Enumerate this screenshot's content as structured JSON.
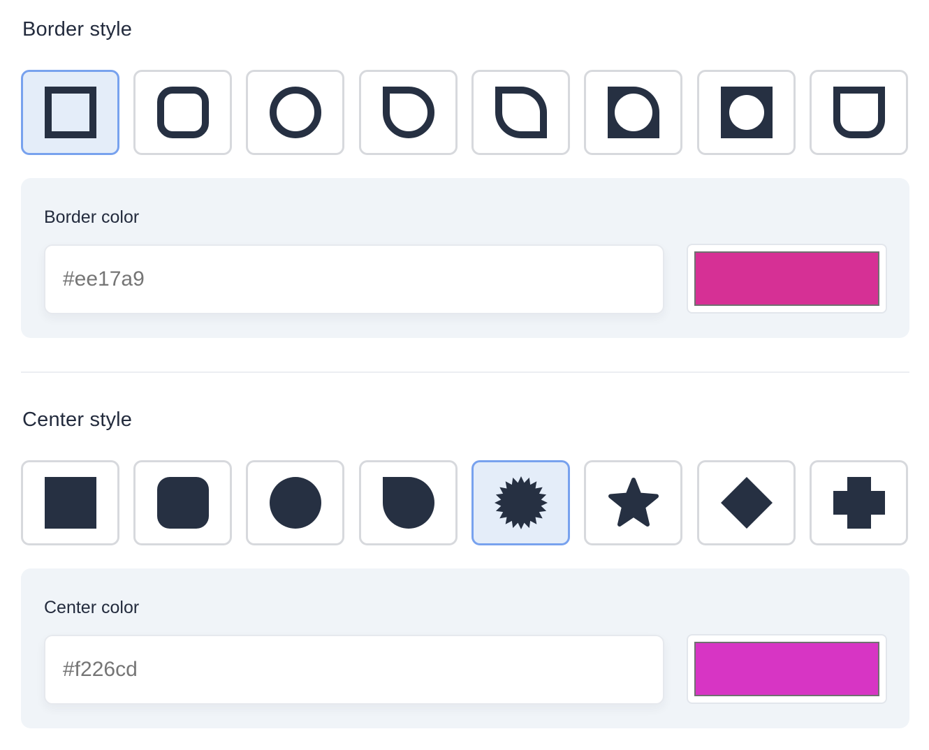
{
  "border_section": {
    "title": "Border style",
    "options": [
      {
        "icon": "square-frame-icon",
        "selected": true
      },
      {
        "icon": "rounded-square-frame-icon",
        "selected": false
      },
      {
        "icon": "circle-frame-icon",
        "selected": false
      },
      {
        "icon": "half-rounded-frame-icon",
        "selected": false
      },
      {
        "icon": "leaf-frame-icon",
        "selected": false
      },
      {
        "icon": "leaf-frame-cutout-icon",
        "selected": false
      },
      {
        "icon": "square-circle-cutout-frame-icon",
        "selected": false
      },
      {
        "icon": "bottom-rounded-frame-icon",
        "selected": false
      }
    ],
    "color_label": "Border color",
    "color_placeholder": "#ee17a9",
    "swatch_color": "#d63095"
  },
  "center_section": {
    "title": "Center style",
    "options": [
      {
        "icon": "square-icon",
        "selected": false
      },
      {
        "icon": "rounded-square-icon",
        "selected": false
      },
      {
        "icon": "circle-icon",
        "selected": false
      },
      {
        "icon": "half-rounded-icon",
        "selected": false
      },
      {
        "icon": "burst-icon",
        "selected": true
      },
      {
        "icon": "star-icon",
        "selected": false
      },
      {
        "icon": "diamond-icon",
        "selected": false
      },
      {
        "icon": "plus-icon",
        "selected": false
      }
    ],
    "color_label": "Center color",
    "color_placeholder": "#f226cd",
    "swatch_color": "#d735c4"
  },
  "colors": {
    "icon_fill": "#263042",
    "selected_border": "#78a2ee",
    "selected_bg": "#e4edf9",
    "panel_bg": "#f0f4f8"
  }
}
